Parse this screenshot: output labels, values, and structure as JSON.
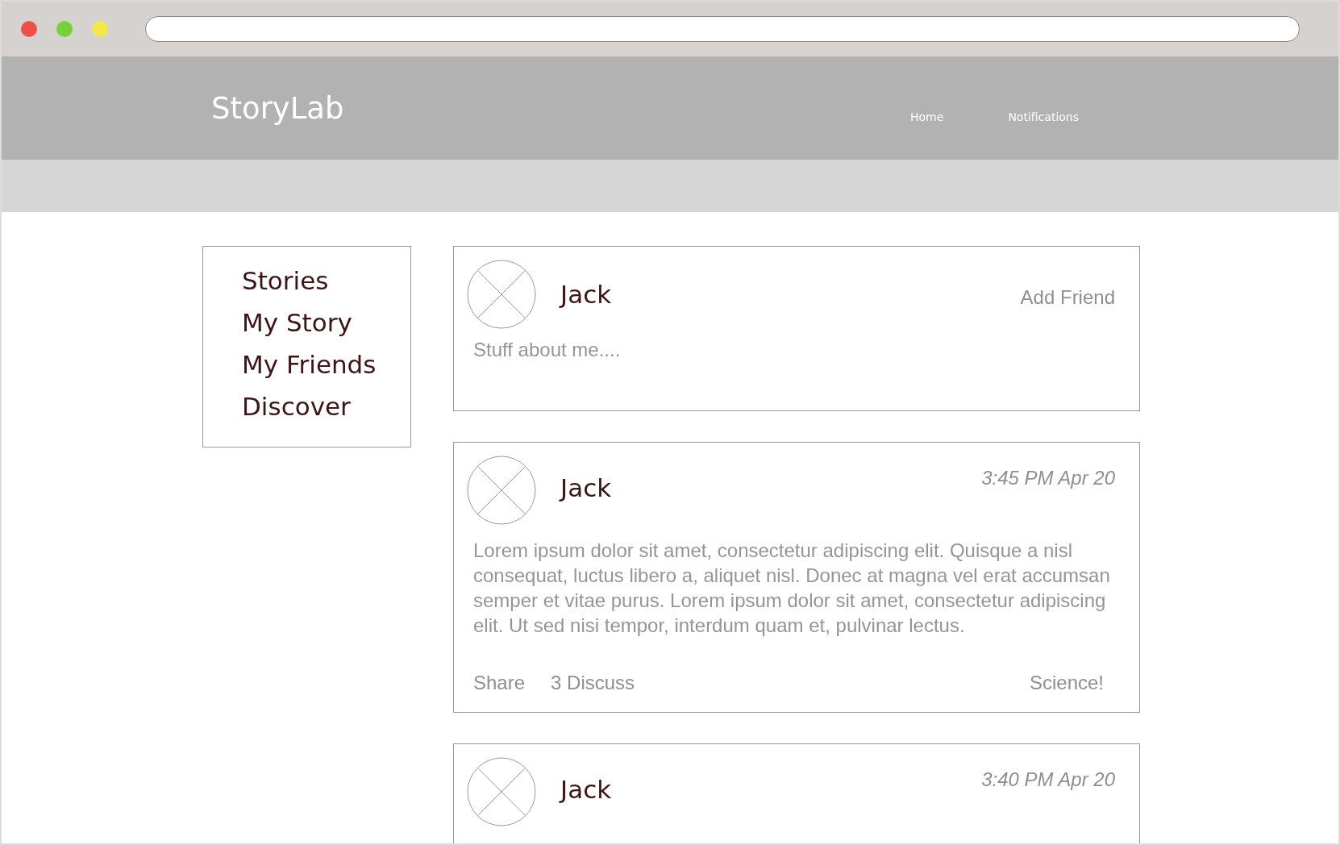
{
  "browser": {
    "controls": [
      {
        "color": "#f0504a"
      },
      {
        "color": "#78cf3a"
      },
      {
        "color": "#f1e84c"
      }
    ]
  },
  "header": {
    "logo": "StoryLab",
    "nav": [
      "Home",
      "Notifications"
    ]
  },
  "sidebar": {
    "items": [
      "Stories",
      "My Story",
      "My Friends",
      "Discover"
    ]
  },
  "feed": [
    {
      "kind": "profile",
      "name": "Jack",
      "action": "Add Friend",
      "about": "Stuff about me...."
    },
    {
      "kind": "post",
      "name": "Jack",
      "time": "3:45 PM Apr 20",
      "body": "Lorem ipsum dolor sit amet, consectetur adipiscing elit. Quisque a nisl consequat, luctus libero a, aliquet nisl. Donec at magna vel erat accumsan semper et vitae purus. Lorem ipsum dolor sit amet, consectetur adipiscing elit. Ut sed nisi tempor, interdum quam et, pulvinar lectus.",
      "actions": [
        "Share",
        "3 Discuss"
      ],
      "tag": "Science!"
    },
    {
      "kind": "post",
      "name": "Jack",
      "time": "3:40 PM Apr 20"
    }
  ]
}
